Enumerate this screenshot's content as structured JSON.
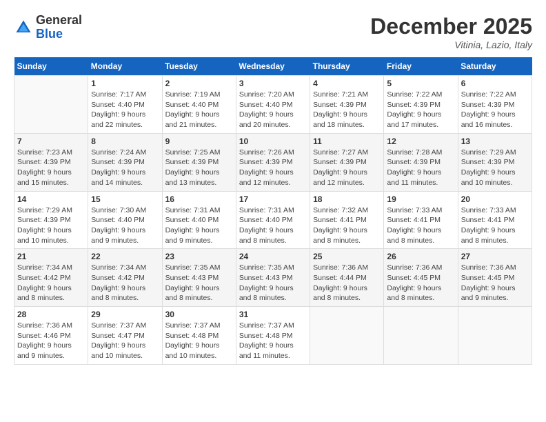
{
  "header": {
    "logo_general": "General",
    "logo_blue": "Blue",
    "month": "December 2025",
    "location": "Vitinia, Lazio, Italy"
  },
  "days_of_week": [
    "Sunday",
    "Monday",
    "Tuesday",
    "Wednesday",
    "Thursday",
    "Friday",
    "Saturday"
  ],
  "weeks": [
    [
      {
        "day": "",
        "info": ""
      },
      {
        "day": "1",
        "info": "Sunrise: 7:17 AM\nSunset: 4:40 PM\nDaylight: 9 hours\nand 22 minutes."
      },
      {
        "day": "2",
        "info": "Sunrise: 7:19 AM\nSunset: 4:40 PM\nDaylight: 9 hours\nand 21 minutes."
      },
      {
        "day": "3",
        "info": "Sunrise: 7:20 AM\nSunset: 4:40 PM\nDaylight: 9 hours\nand 20 minutes."
      },
      {
        "day": "4",
        "info": "Sunrise: 7:21 AM\nSunset: 4:39 PM\nDaylight: 9 hours\nand 18 minutes."
      },
      {
        "day": "5",
        "info": "Sunrise: 7:22 AM\nSunset: 4:39 PM\nDaylight: 9 hours\nand 17 minutes."
      },
      {
        "day": "6",
        "info": "Sunrise: 7:22 AM\nSunset: 4:39 PM\nDaylight: 9 hours\nand 16 minutes."
      }
    ],
    [
      {
        "day": "7",
        "info": "Sunrise: 7:23 AM\nSunset: 4:39 PM\nDaylight: 9 hours\nand 15 minutes."
      },
      {
        "day": "8",
        "info": "Sunrise: 7:24 AM\nSunset: 4:39 PM\nDaylight: 9 hours\nand 14 minutes."
      },
      {
        "day": "9",
        "info": "Sunrise: 7:25 AM\nSunset: 4:39 PM\nDaylight: 9 hours\nand 13 minutes."
      },
      {
        "day": "10",
        "info": "Sunrise: 7:26 AM\nSunset: 4:39 PM\nDaylight: 9 hours\nand 12 minutes."
      },
      {
        "day": "11",
        "info": "Sunrise: 7:27 AM\nSunset: 4:39 PM\nDaylight: 9 hours\nand 12 minutes."
      },
      {
        "day": "12",
        "info": "Sunrise: 7:28 AM\nSunset: 4:39 PM\nDaylight: 9 hours\nand 11 minutes."
      },
      {
        "day": "13",
        "info": "Sunrise: 7:29 AM\nSunset: 4:39 PM\nDaylight: 9 hours\nand 10 minutes."
      }
    ],
    [
      {
        "day": "14",
        "info": "Sunrise: 7:29 AM\nSunset: 4:39 PM\nDaylight: 9 hours\nand 10 minutes."
      },
      {
        "day": "15",
        "info": "Sunrise: 7:30 AM\nSunset: 4:40 PM\nDaylight: 9 hours\nand 9 minutes."
      },
      {
        "day": "16",
        "info": "Sunrise: 7:31 AM\nSunset: 4:40 PM\nDaylight: 9 hours\nand 9 minutes."
      },
      {
        "day": "17",
        "info": "Sunrise: 7:31 AM\nSunset: 4:40 PM\nDaylight: 9 hours\nand 8 minutes."
      },
      {
        "day": "18",
        "info": "Sunrise: 7:32 AM\nSunset: 4:41 PM\nDaylight: 9 hours\nand 8 minutes."
      },
      {
        "day": "19",
        "info": "Sunrise: 7:33 AM\nSunset: 4:41 PM\nDaylight: 9 hours\nand 8 minutes."
      },
      {
        "day": "20",
        "info": "Sunrise: 7:33 AM\nSunset: 4:41 PM\nDaylight: 9 hours\nand 8 minutes."
      }
    ],
    [
      {
        "day": "21",
        "info": "Sunrise: 7:34 AM\nSunset: 4:42 PM\nDaylight: 9 hours\nand 8 minutes."
      },
      {
        "day": "22",
        "info": "Sunrise: 7:34 AM\nSunset: 4:42 PM\nDaylight: 9 hours\nand 8 minutes."
      },
      {
        "day": "23",
        "info": "Sunrise: 7:35 AM\nSunset: 4:43 PM\nDaylight: 9 hours\nand 8 minutes."
      },
      {
        "day": "24",
        "info": "Sunrise: 7:35 AM\nSunset: 4:43 PM\nDaylight: 9 hours\nand 8 minutes."
      },
      {
        "day": "25",
        "info": "Sunrise: 7:36 AM\nSunset: 4:44 PM\nDaylight: 9 hours\nand 8 minutes."
      },
      {
        "day": "26",
        "info": "Sunrise: 7:36 AM\nSunset: 4:45 PM\nDaylight: 9 hours\nand 8 minutes."
      },
      {
        "day": "27",
        "info": "Sunrise: 7:36 AM\nSunset: 4:45 PM\nDaylight: 9 hours\nand 9 minutes."
      }
    ],
    [
      {
        "day": "28",
        "info": "Sunrise: 7:36 AM\nSunset: 4:46 PM\nDaylight: 9 hours\nand 9 minutes."
      },
      {
        "day": "29",
        "info": "Sunrise: 7:37 AM\nSunset: 4:47 PM\nDaylight: 9 hours\nand 10 minutes."
      },
      {
        "day": "30",
        "info": "Sunrise: 7:37 AM\nSunset: 4:48 PM\nDaylight: 9 hours\nand 10 minutes."
      },
      {
        "day": "31",
        "info": "Sunrise: 7:37 AM\nSunset: 4:48 PM\nDaylight: 9 hours\nand 11 minutes."
      },
      {
        "day": "",
        "info": ""
      },
      {
        "day": "",
        "info": ""
      },
      {
        "day": "",
        "info": ""
      }
    ]
  ]
}
